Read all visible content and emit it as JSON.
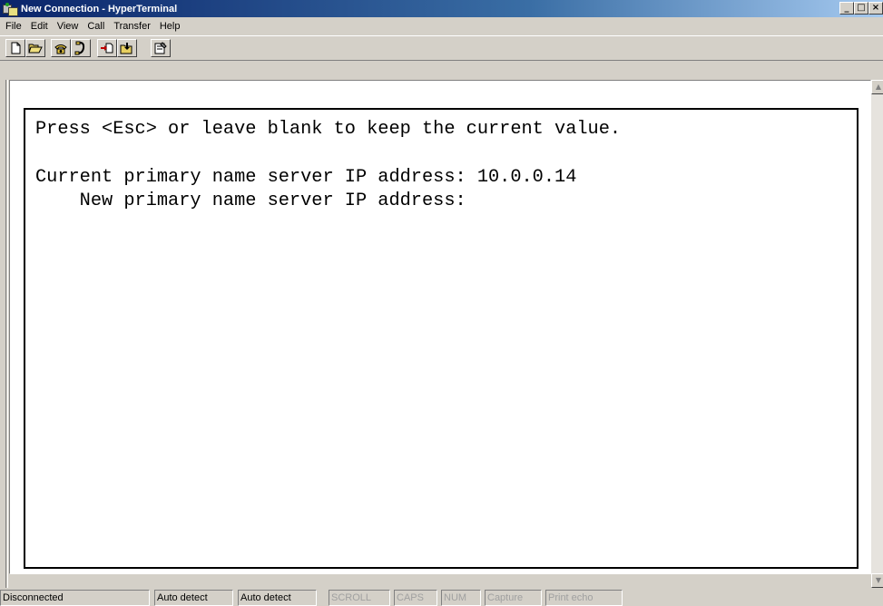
{
  "window": {
    "title": "New Connection - HyperTerminal",
    "minimize_glyph": "_",
    "maximize_glyph": "□",
    "close_glyph": "×"
  },
  "menu": {
    "items": [
      "File",
      "Edit",
      "View",
      "Call",
      "Transfer",
      "Help"
    ]
  },
  "toolbar": {
    "icons": [
      "new-document-icon",
      "open-folder-icon",
      "call-phone-icon",
      "disconnect-phone-icon",
      "send-file-icon",
      "receive-file-icon",
      "properties-icon"
    ]
  },
  "terminal": {
    "lines": [
      "Press <Esc> or leave blank to keep the current value.",
      "Current primary name server IP address: 10.0.0.14",
      "    New primary name server IP address:"
    ]
  },
  "scrollbar": {
    "up_glyph": "▲",
    "down_glyph": "▼"
  },
  "status": {
    "connection": "Disconnected",
    "detect1": "Auto detect",
    "detect2": "Auto detect",
    "scroll": "SCROLL",
    "caps": "CAPS",
    "num": "NUM",
    "capture": "Capture",
    "print_echo": "Print echo"
  }
}
